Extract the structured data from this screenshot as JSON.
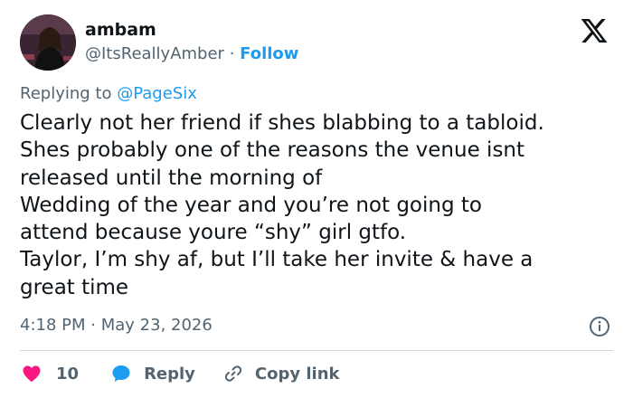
{
  "author": {
    "name": "ambam",
    "handle": "@ItsReallyAmber",
    "separator": "·",
    "follow_label": "Follow"
  },
  "reply_context": {
    "prefix": "Replying to",
    "mention": "@PageSix"
  },
  "tweet": {
    "lines": [
      "Clearly not her friend if shes blabbing to a tabloid.",
      "Shes probably one of the reasons the venue isnt",
      "released until the morning of",
      "Wedding of the year and you’re not going to",
      "attend because youre “shy” girl gtfo.",
      "Taylor, I’m shy af, but I’ll take her invite & have a",
      "great time"
    ]
  },
  "meta": {
    "time": "4:18 PM",
    "separator": "·",
    "date": "May 23, 2026"
  },
  "actions": {
    "like_count": "10",
    "reply_label": "Reply",
    "copy_link_label": "Copy link"
  },
  "icons": {
    "brand": "x-logo",
    "info": "info-icon",
    "like": "heart-icon",
    "reply": "speech-bubble-icon",
    "copy": "link-icon"
  },
  "colors": {
    "text_primary": "#0f1419",
    "text_secondary": "#536471",
    "accent_blue": "#1d9bf0",
    "like_red": "#f91880",
    "divider": "#cfd9de"
  }
}
